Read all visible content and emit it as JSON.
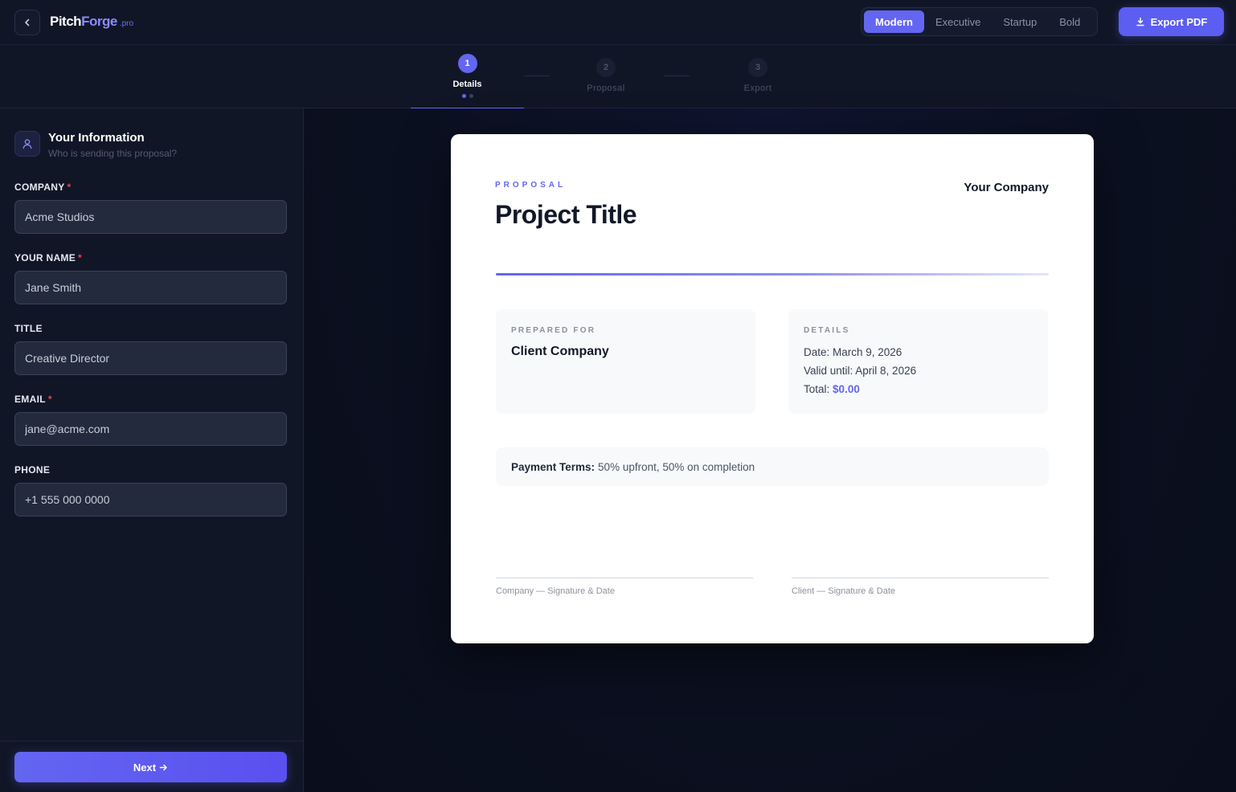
{
  "header": {
    "logo_part1": "Pitch",
    "logo_part2": "Forge",
    "logo_suffix": ".pro",
    "themes": [
      "Modern",
      "Executive",
      "Startup",
      "Bold"
    ],
    "active_theme": "Modern",
    "export_label": "Export PDF"
  },
  "stepper": {
    "steps": [
      {
        "num": "1",
        "label": "Details"
      },
      {
        "num": "2",
        "label": "Proposal"
      },
      {
        "num": "3",
        "label": "Export"
      }
    ],
    "active_step": 1
  },
  "sidebar": {
    "section_title": "Your Information",
    "section_subtitle": "Who is sending this proposal?",
    "fields": [
      {
        "label": "COMPANY",
        "required": true,
        "value": "Acme Studios"
      },
      {
        "label": "YOUR NAME",
        "required": true,
        "value": "Jane Smith"
      },
      {
        "label": "TITLE",
        "required": false,
        "value": "Creative Director"
      },
      {
        "label": "EMAIL",
        "required": true,
        "value": "jane@acme.com"
      },
      {
        "label": "PHONE",
        "required": false,
        "value": "+1 555 000 0000"
      }
    ],
    "next_label": "Next"
  },
  "document": {
    "eyebrow": "PROPOSAL",
    "title": "Project Title",
    "company": "Your Company",
    "prepared_for_label": "PREPARED FOR",
    "client": "Client Company",
    "details_label": "DETAILS",
    "date_line": "Date: March 9, 2026",
    "valid_line": "Valid until: April 8, 2026",
    "total_label": "Total:",
    "total_value": "$0.00",
    "terms_label": "Payment Terms:",
    "terms_value": "50% upfront, 50% on completion",
    "sig_company": "Company — Signature & Date",
    "sig_client": "Client — Signature & Date"
  },
  "colors": {
    "accent": "#6366f1",
    "background": "#0b1020",
    "panel": "#111627",
    "required": "#ef4444"
  },
  "icons": {
    "back": "chevron-left-icon",
    "export": "download-icon",
    "section": "user-icon",
    "next": "arrow-right-icon"
  }
}
